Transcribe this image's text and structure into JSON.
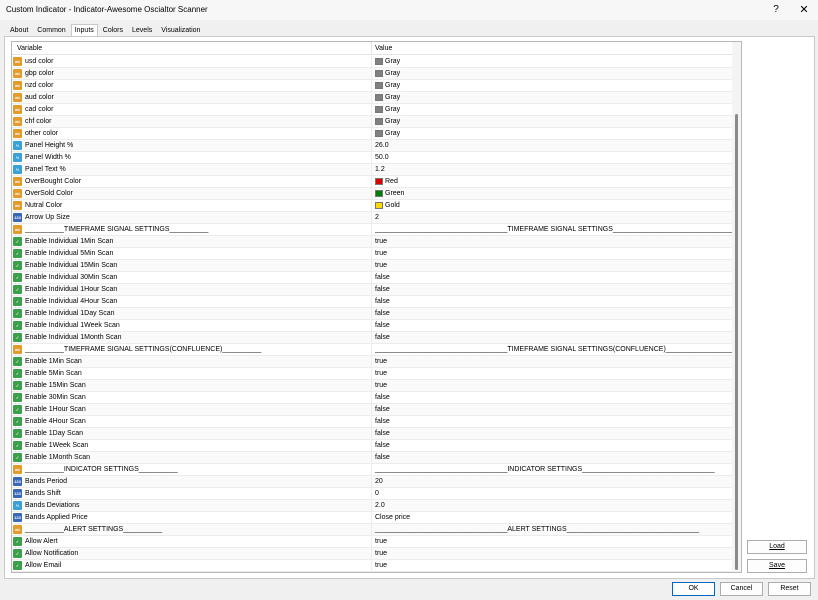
{
  "window": {
    "title": "Custom Indicator - Indicator-Awesome Oscialtor Scanner",
    "help_label": "?",
    "close_label": "✕"
  },
  "tabs": [
    {
      "label": "About"
    },
    {
      "label": "Common"
    },
    {
      "label": "Inputs",
      "active": true
    },
    {
      "label": "Colors"
    },
    {
      "label": "Levels"
    },
    {
      "label": "Visualization"
    }
  ],
  "table": {
    "headers": {
      "variable": "Variable",
      "value": "Value"
    },
    "rows": [
      {
        "icon": "color",
        "name": "usd color",
        "value": "Gray",
        "color": "#808080"
      },
      {
        "icon": "color",
        "name": "gbp color",
        "value": "Gray",
        "color": "#808080"
      },
      {
        "icon": "color",
        "name": "nzd color",
        "value": "Gray",
        "color": "#808080"
      },
      {
        "icon": "color",
        "name": "aud color",
        "value": "Gray",
        "color": "#808080"
      },
      {
        "icon": "color",
        "name": "cad color",
        "value": "Gray",
        "color": "#808080"
      },
      {
        "icon": "color",
        "name": "chf color",
        "value": "Gray",
        "color": "#808080"
      },
      {
        "icon": "color",
        "name": "other color",
        "value": "Gray",
        "color": "#808080"
      },
      {
        "icon": "double",
        "name": "Panel Height %",
        "value": "26.0"
      },
      {
        "icon": "double",
        "name": "Panel Width %",
        "value": "50.0"
      },
      {
        "icon": "double",
        "name": "Panel Text %",
        "value": "1.2"
      },
      {
        "icon": "color",
        "name": "OverBought Color",
        "value": "Red",
        "color": "#e00000"
      },
      {
        "icon": "color",
        "name": "OverSold Color",
        "value": "Green",
        "color": "#008000"
      },
      {
        "icon": "color",
        "name": "Nutral Color",
        "value": "Gold",
        "color": "#ffd700"
      },
      {
        "icon": "int",
        "name": "Arrow Up Size",
        "value": "2"
      },
      {
        "icon": "string",
        "name": "__________TIMEFRAME SIGNAL SETTINGS__________",
        "value": "__________________________________TIMEFRAME SIGNAL SETTINGS__________________________________"
      },
      {
        "icon": "bool",
        "name": "Enable Individual 1Min Scan",
        "value": "true"
      },
      {
        "icon": "bool",
        "name": "Enable Individual 5Min Scan",
        "value": "true"
      },
      {
        "icon": "bool",
        "name": "Enable Individual 15Min Scan",
        "value": "true"
      },
      {
        "icon": "bool",
        "name": "Enable Individual 30Min Scan",
        "value": "false"
      },
      {
        "icon": "bool",
        "name": "Enable Individual 1Hour Scan",
        "value": "false"
      },
      {
        "icon": "bool",
        "name": "Enable Individual 4Hour Scan",
        "value": "false"
      },
      {
        "icon": "bool",
        "name": "Enable Individual 1Day Scan",
        "value": "false"
      },
      {
        "icon": "bool",
        "name": "Enable Individual 1Week Scan",
        "value": "false"
      },
      {
        "icon": "bool",
        "name": "Enable Individual 1Month Scan",
        "value": "false"
      },
      {
        "icon": "string",
        "name": "__________TIMEFRAME SIGNAL SETTINGS(CONFLUENCE)__________",
        "value": "__________________________________TIMEFRAME SIGNAL SETTINGS(CONFLUENCE)__________________________"
      },
      {
        "icon": "bool",
        "name": "Enable 1Min Scan",
        "value": "true"
      },
      {
        "icon": "bool",
        "name": "Enable 5Min Scan",
        "value": "true"
      },
      {
        "icon": "bool",
        "name": "Enable 15Min Scan",
        "value": "true"
      },
      {
        "icon": "bool",
        "name": "Enable 30Min Scan",
        "value": "false"
      },
      {
        "icon": "bool",
        "name": "Enable 1Hour Scan",
        "value": "false"
      },
      {
        "icon": "bool",
        "name": "Enable 4Hour Scan",
        "value": "false"
      },
      {
        "icon": "bool",
        "name": "Enable 1Day Scan",
        "value": "false"
      },
      {
        "icon": "bool",
        "name": "Enable 1Week Scan",
        "value": "false"
      },
      {
        "icon": "bool",
        "name": "Enable 1Month Scan",
        "value": "false"
      },
      {
        "icon": "string",
        "name": "__________INDICATOR SETTINGS__________",
        "value": "__________________________________INDICATOR SETTINGS__________________________________"
      },
      {
        "icon": "int",
        "name": "Bands Period",
        "value": "20"
      },
      {
        "icon": "int",
        "name": "Bands Shift",
        "value": "0"
      },
      {
        "icon": "double",
        "name": "Bands Deviations",
        "value": "2.0"
      },
      {
        "icon": "int",
        "name": "Bands Applied Price",
        "value": "Close price"
      },
      {
        "icon": "string",
        "name": "__________ALERT SETTINGS__________",
        "value": "__________________________________ALERT SETTINGS__________________________________"
      },
      {
        "icon": "bool",
        "name": "Allow Alert",
        "value": "true"
      },
      {
        "icon": "bool",
        "name": "Allow Notification",
        "value": "true"
      },
      {
        "icon": "bool",
        "name": "Allow Email",
        "value": "true"
      }
    ]
  },
  "side_buttons": {
    "load": "Load",
    "save": "Save"
  },
  "footer_buttons": {
    "ok": "OK",
    "cancel": "Cancel",
    "reset": "Reset"
  }
}
